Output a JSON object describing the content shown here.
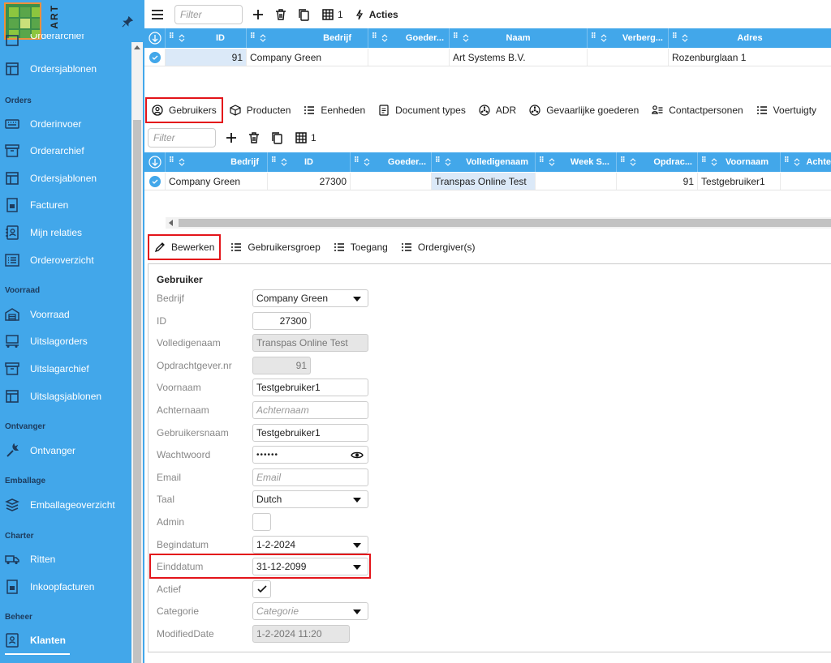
{
  "logo": {
    "text": "ART"
  },
  "sidebar": {
    "cut_item": "Orderarchief",
    "top_item": "Ordersjablonen",
    "sections": [
      "Orders",
      "Voorraad",
      "Ontvanger",
      "Emballage",
      "Charter",
      "Beheer"
    ],
    "items": [
      {
        "label": "Orderinvoer",
        "icon": "keyboard-icon"
      },
      {
        "label": "Orderarchief",
        "icon": "archive-icon"
      },
      {
        "label": "Ordersjablonen",
        "icon": "template-icon"
      },
      {
        "label": "Facturen",
        "icon": "invoice-icon"
      },
      {
        "label": "Mijn relaties",
        "icon": "contacts-icon"
      },
      {
        "label": "Orderoverzicht",
        "icon": "list-icon"
      },
      {
        "label": "Voorraad",
        "icon": "warehouse-icon"
      },
      {
        "label": "Uitslagorders",
        "icon": "forklift-icon"
      },
      {
        "label": "Uitslagarchief",
        "icon": "archive-icon"
      },
      {
        "label": "Uitslagsjablonen",
        "icon": "template-icon"
      },
      {
        "label": "Ontvanger",
        "icon": "wrench-icon"
      },
      {
        "label": "Emballageoverzicht",
        "icon": "boxes-icon"
      },
      {
        "label": "Ritten",
        "icon": "truck-icon"
      },
      {
        "label": "Inkoopfacturen",
        "icon": "invoice-icon"
      },
      {
        "label": "Klanten",
        "icon": "contacts-icon"
      }
    ]
  },
  "toolbar1": {
    "filter": "Filter",
    "layout_count": "1",
    "actions": "Acties"
  },
  "grid1": {
    "headers": [
      "ID",
      "Bedrijf",
      "Goeder...",
      "Naam",
      "Verberg...",
      "Adres"
    ],
    "row": {
      "id": "91",
      "bedrijf": "Company Green",
      "goeder": "",
      "naam": "Art Systems B.V.",
      "verberg": "",
      "adres": "Rozenburglaan 1"
    }
  },
  "tabs1": [
    "Gebruikers",
    "Producten",
    "Eenheden",
    "Document types",
    "ADR",
    "Gevaarlijke goederen",
    "Contactpersonen",
    "Voertuigty"
  ],
  "toolbar2": {
    "filter": "Filter",
    "layout_count": "1"
  },
  "grid2": {
    "headers": [
      "Bedrijf",
      "ID",
      "Goeder...",
      "Volledigenaam",
      "Week S...",
      "Opdrac...",
      "Voornaam",
      "Achte"
    ],
    "row": {
      "bedrijf": "Company Green",
      "id": "27300",
      "goeder": "",
      "volledigenaam": "Transpas Online Test",
      "week": "",
      "opdrac": "91",
      "voornaam": "Testgebruiker1",
      "achte": ""
    }
  },
  "tabs2": [
    "Bewerken",
    "Gebruikersgroep",
    "Toegang",
    "Ordergiver(s)"
  ],
  "form": {
    "title": "Gebruiker",
    "labels": [
      "Bedrijf",
      "ID",
      "Volledigenaam",
      "Opdrachtgever.nr",
      "Voornaam",
      "Achternaam",
      "Gebruikersnaam",
      "Wachtwoord",
      "Email",
      "Taal",
      "Admin",
      "Begindatum",
      "Einddatum",
      "Actief",
      "Categorie",
      "ModifiedDate"
    ],
    "bedrijf": "Company Green",
    "id": "27300",
    "volledigenaam": "Transpas Online Test",
    "opdrachtgever": "91",
    "voornaam": "Testgebruiker1",
    "achternaam_ph": "Achternaam",
    "gebruikersnaam": "Testgebruiker1",
    "wachtwoord": "••••••",
    "email_ph": "Email",
    "taal": "Dutch",
    "admin_checked": false,
    "begindatum": "1-2-2024",
    "einddatum": "31-12-2099",
    "actief_checked": true,
    "categorie_ph": "Categorie",
    "modified": "1-2-2024 11:20"
  },
  "colors": {
    "sidebar": "#42a7ea",
    "header": "#42a7ea",
    "highlight": "#e3141a",
    "section": "#1e3b5c"
  }
}
